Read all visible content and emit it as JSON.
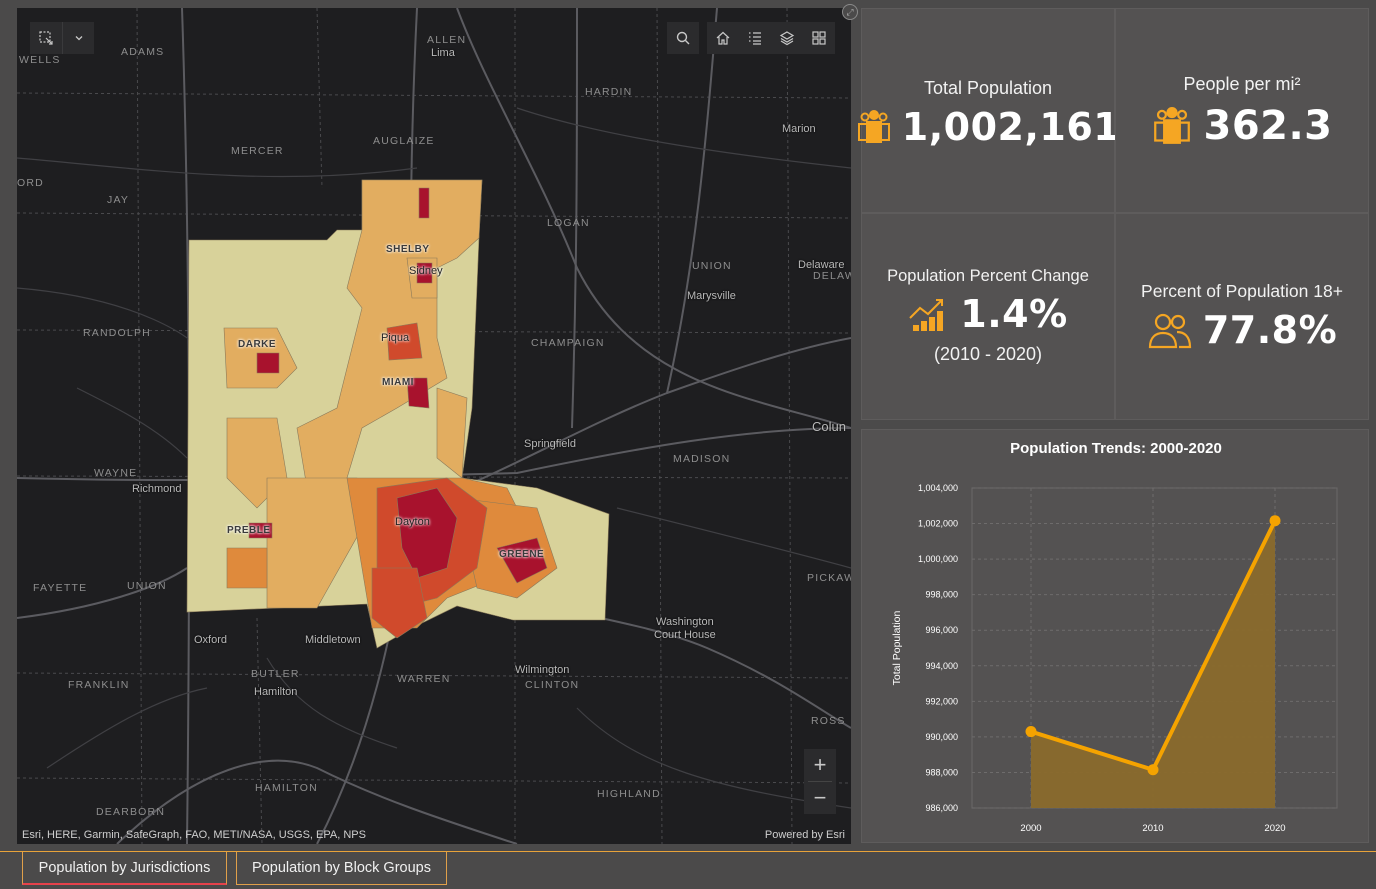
{
  "map": {
    "attribution": "Esri, HERE, Garmin, SafeGraph, FAO, METI/NASA, USGS, EPA, NPS",
    "powered_by": "Powered by Esri",
    "zoom_in": "+",
    "zoom_out": "−",
    "region_labels": [
      {
        "text": "WELLS"
      },
      {
        "text": "ADAMS"
      },
      {
        "text": "ALLEN"
      },
      {
        "text": "HARDIN"
      },
      {
        "text": "MERCER"
      },
      {
        "text": "AUGLAIZE"
      },
      {
        "text": "ORD"
      },
      {
        "text": "JAY"
      },
      {
        "text": "LOGAN"
      },
      {
        "text": "UNION"
      },
      {
        "text": "DELAW"
      },
      {
        "text": "RANDOLPH"
      },
      {
        "text": "CHAMPAIGN"
      },
      {
        "text": "MADISON"
      },
      {
        "text": "WAYNE"
      },
      {
        "text": "FAYETTE"
      },
      {
        "text": "UNION"
      },
      {
        "text": "PICKAW"
      },
      {
        "text": "BUTLER"
      },
      {
        "text": "WARREN"
      },
      {
        "text": "CLINTON"
      },
      {
        "text": "FRANKLIN"
      },
      {
        "text": "ROSS"
      },
      {
        "text": "HAMILTON"
      },
      {
        "text": "DEARBORN"
      },
      {
        "text": "HIGHLAND"
      }
    ],
    "city_labels": [
      {
        "text": "Lima"
      },
      {
        "text": "Marion"
      },
      {
        "text": "Delaware"
      },
      {
        "text": "Marysville"
      },
      {
        "text": "Springfield"
      },
      {
        "text": "Colun"
      },
      {
        "text": "Richmond"
      },
      {
        "text": "Oxford"
      },
      {
        "text": "Middletown"
      },
      {
        "text": "Hamilton"
      },
      {
        "text": "Wilmington"
      },
      {
        "text": "Washington"
      },
      {
        "text": "Court House"
      },
      {
        "text": "Sidney"
      },
      {
        "text": "Piqua"
      },
      {
        "text": "Dayton"
      }
    ],
    "county_labels": [
      {
        "text": "SHELBY"
      },
      {
        "text": "DARKE"
      },
      {
        "text": "MIAMI"
      },
      {
        "text": "PREBLE"
      },
      {
        "text": "GREENE"
      }
    ],
    "colors": {
      "light": "#d8d29a",
      "mid": "#e2ad60",
      "orange": "#df8a3c",
      "red": "#d04a2c",
      "dark": "#a8122d"
    }
  },
  "stats": {
    "total_population": {
      "title": "Total Population",
      "value": "1,002,161",
      "icon": "people-group-icon"
    },
    "density": {
      "title": "People per mi²",
      "value": "362.3",
      "icon": "people-group-icon"
    },
    "percent_change": {
      "title": "Population Percent Change",
      "value": "1.4%",
      "subtitle": "(2010 - 2020)",
      "icon": "growth-chart-icon"
    },
    "adults": {
      "title": "Percent of Population 18+",
      "value": "77.8%",
      "icon": "two-people-icon"
    },
    "accent": "#f5a623"
  },
  "chart_data": {
    "type": "area",
    "title": "Population Trends: 2000-2020",
    "xlabel": "",
    "ylabel": "Total Population",
    "categories": [
      "2000",
      "2010",
      "2020"
    ],
    "values": [
      990300,
      988150,
      1002161
    ],
    "ylim": [
      986000,
      1004000
    ],
    "yticks": [
      "986,000",
      "988,000",
      "990,000",
      "992,000",
      "994,000",
      "996,000",
      "998,000",
      "1,000,000",
      "1,002,000",
      "1,004,000"
    ],
    "grid": true,
    "color": "#f5a300"
  },
  "tabs": [
    {
      "label": "Population by Jurisdictions",
      "active": true
    },
    {
      "label": "Population by Block Groups",
      "active": false
    }
  ]
}
